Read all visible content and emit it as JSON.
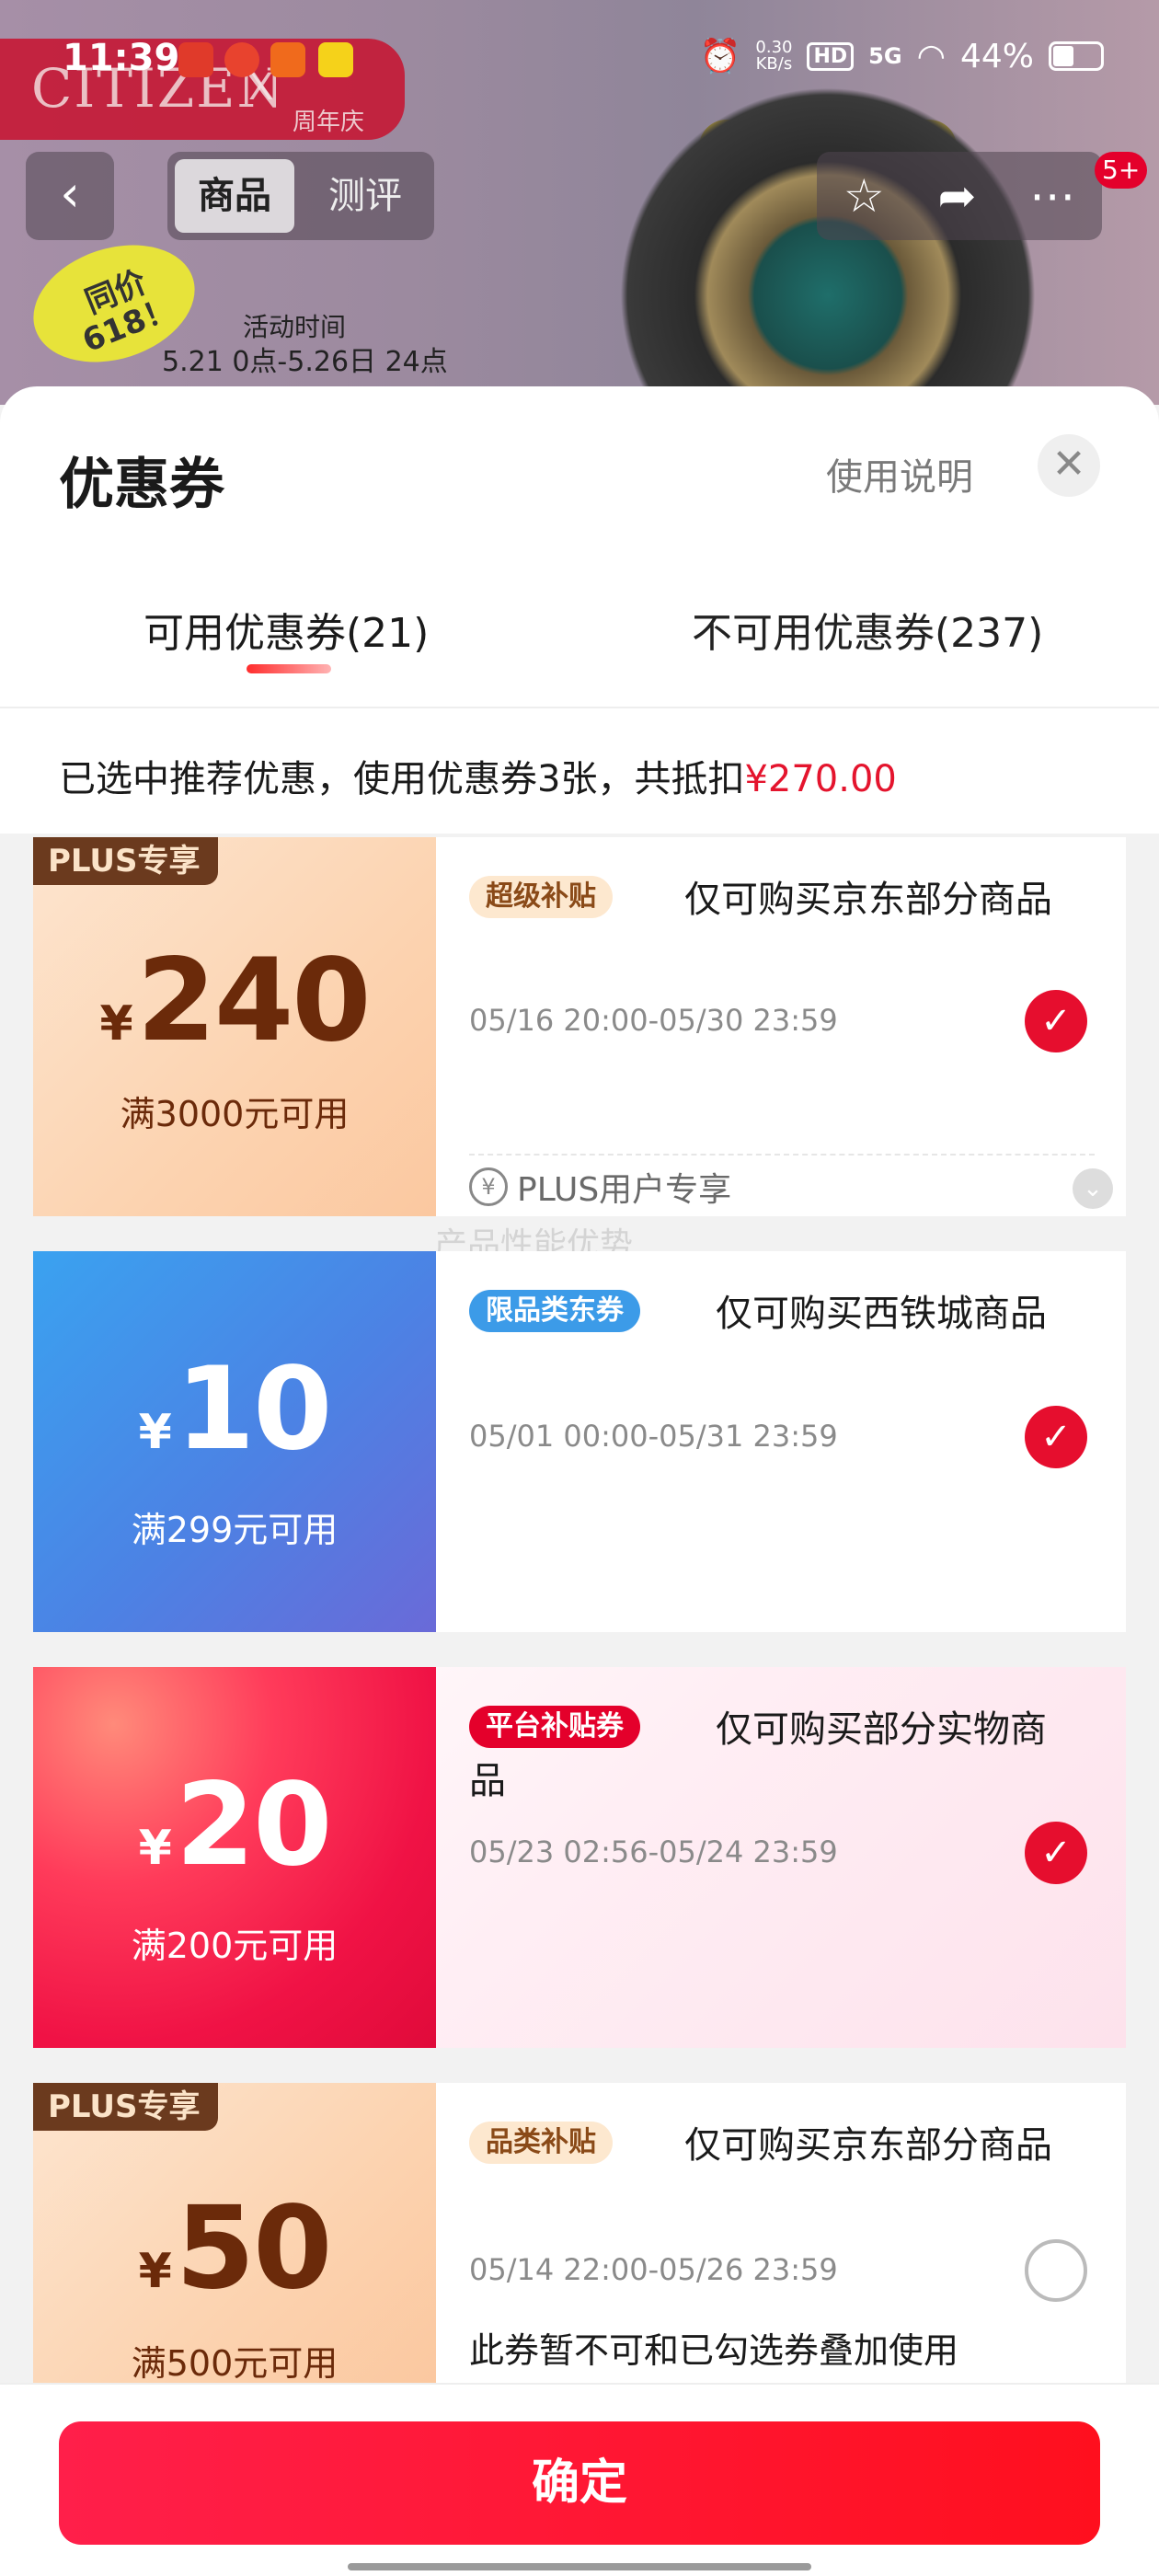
{
  "status_bar": {
    "time": "11:39",
    "net_speed_value": "0.30",
    "net_speed_unit": "KB/s",
    "hd": "HD",
    "signal": "5G",
    "battery": "44%"
  },
  "hero": {
    "brand": "CITIZEN",
    "brand_x": "X",
    "anniversary": "周年庆",
    "promo": "同价618！",
    "activity_title": "活动时间",
    "activity_dates": "5.21 0点-5.26日 24点"
  },
  "nav": {
    "back_icon": "chevron-left-icon",
    "tabs": [
      {
        "label": "商品"
      },
      {
        "label": "测评"
      }
    ],
    "badge": "5+"
  },
  "sheet": {
    "title": "优惠券",
    "usage_link": "使用说明",
    "tabs": {
      "available": "可用优惠券(21)",
      "unavailable": "不可用优惠券(237)"
    },
    "summary_prefix": "已选中推荐优惠，使用优惠券3张，共抵扣",
    "summary_amount": "¥270.00",
    "watermark": "产品性能优势"
  },
  "coupons": [
    {
      "plus_badge": "PLUS专享",
      "currency": "¥",
      "amount": "240",
      "condition": "满3000元可用",
      "tag": "超级补贴",
      "title": "仅可购买京东部分商品",
      "validity": "05/16 20:00-05/30 23:59",
      "selected": true,
      "footer": "PLUS用户专享",
      "footer_icon_text": "¥"
    },
    {
      "currency": "¥",
      "amount": "10",
      "condition": "满299元可用",
      "tag": "限品类东券",
      "title": "仅可购买西铁城商品",
      "validity": "05/01 00:00-05/31 23:59",
      "selected": true
    },
    {
      "currency": "¥",
      "amount": "20",
      "condition": "满200元可用",
      "tag": "平台补贴券",
      "title_line1": "仅可购买部分实物商",
      "title_line2": "品",
      "validity": "05/23 02:56-05/24 23:59",
      "selected": true
    },
    {
      "plus_badge": "PLUS专享",
      "currency": "¥",
      "amount": "50",
      "condition": "满500元可用",
      "tag": "品类补贴",
      "title": "仅可购买京东部分商品",
      "validity": "05/14 22:00-05/26 23:59",
      "selected": false,
      "note": "此券暂不可和已勾选券叠加使用"
    }
  ],
  "confirm_button": "确定",
  "colors": {
    "accent_red": "#e4142d",
    "check_red": "#e60e2e",
    "plus_brown": "#6b3a1e",
    "blue_coupon": "#4c82e4"
  }
}
